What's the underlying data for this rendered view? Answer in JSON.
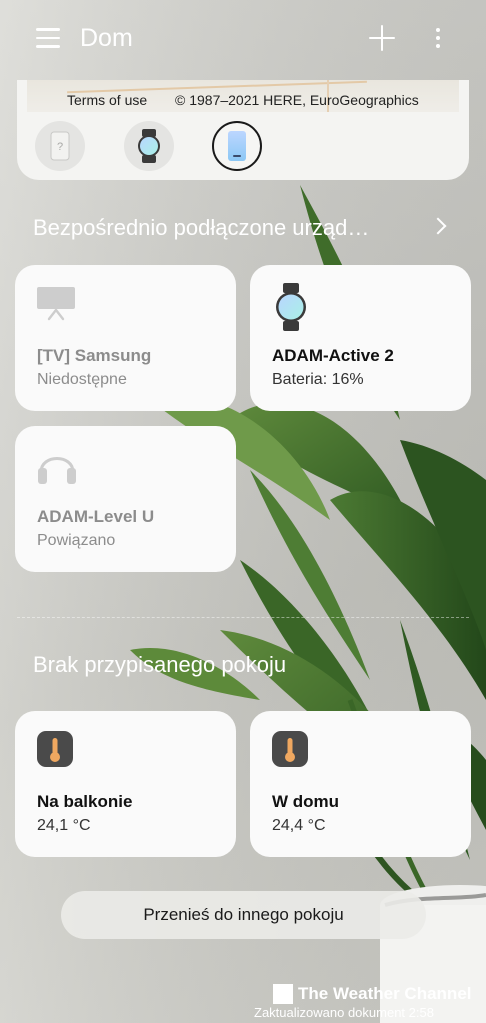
{
  "header": {
    "title": "Dom"
  },
  "map": {
    "terms": "Terms of use",
    "copyright": "© 1987–2021 HERE, EuroGeographics"
  },
  "device_strip": [
    {
      "icon": "unknown-phone-icon"
    },
    {
      "icon": "watch-icon"
    },
    {
      "icon": "phone-icon",
      "selected": true
    }
  ],
  "sections": {
    "connected": "Bezpośrednio podłączone urząd…",
    "unassigned": "Brak przypisanego pokoju"
  },
  "connected_devices": [
    {
      "name": "[TV] Samsung",
      "status": "Niedostępne",
      "icon": "tv-icon"
    },
    {
      "name": "ADAM-Active 2",
      "status": "Bateria: 16%",
      "icon": "watch-icon"
    },
    {
      "name": "ADAM-Level U",
      "status": "Powiązano",
      "icon": "headphones-icon"
    }
  ],
  "unassigned_devices": [
    {
      "name": "Na balkonie",
      "status": "24,1 °C",
      "icon": "thermometer-icon"
    },
    {
      "name": "W domu",
      "status": "24,4 °C",
      "icon": "thermometer-icon"
    }
  ],
  "move_button": "Przenieś do innego pokoju",
  "weather": {
    "logo_text": "The Weather Channel",
    "brand": "The Weather Channel",
    "updated": "Zaktualizowano dokument 2:58"
  },
  "colors": {
    "card": "#fafafa",
    "thermo_tile": "#4a4a4a",
    "thermo_accent": "#f0a860",
    "watch_gradient_start": "#b9d6ff",
    "watch_gradient_end": "#a9f0e6"
  }
}
